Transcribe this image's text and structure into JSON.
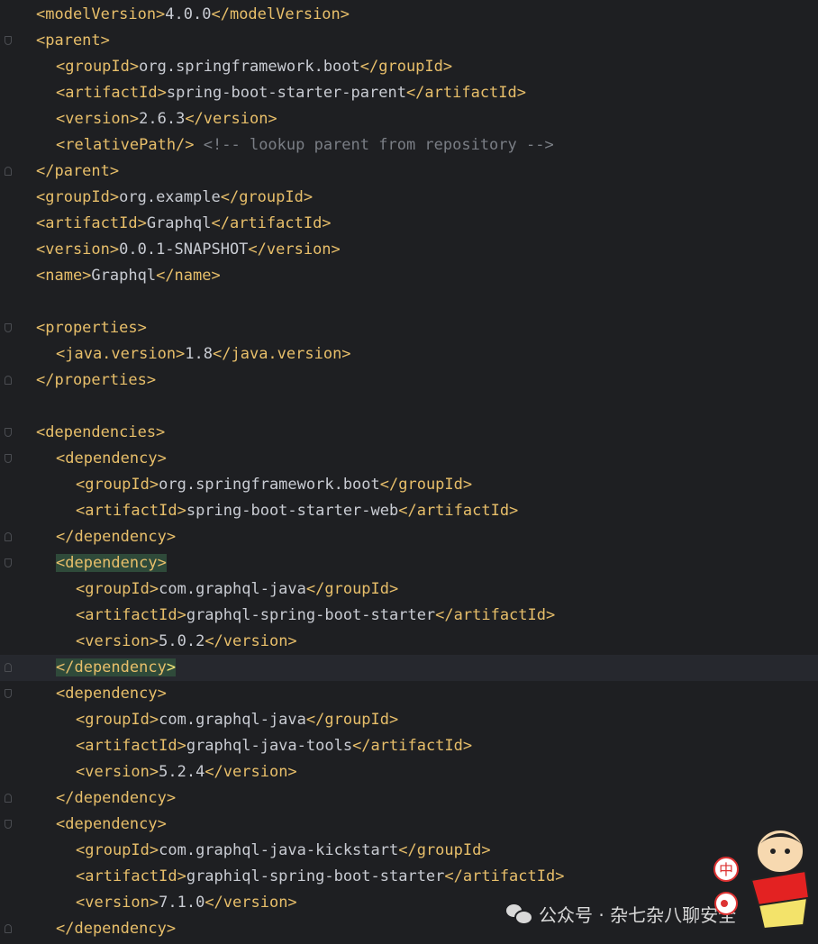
{
  "editor": {
    "lines": [
      {
        "indent": 0,
        "fold": "",
        "segments": [
          [
            "tag",
            "<modelVersion>"
          ],
          [
            "text",
            "4.0.0"
          ],
          [
            "tag",
            "</modelVersion>"
          ]
        ]
      },
      {
        "indent": 0,
        "fold": "down",
        "segments": [
          [
            "tag",
            "<parent>"
          ]
        ]
      },
      {
        "indent": 1,
        "fold": "",
        "segments": [
          [
            "tag",
            "<groupId>"
          ],
          [
            "text",
            "org.springframework.boot"
          ],
          [
            "tag",
            "</groupId>"
          ]
        ]
      },
      {
        "indent": 1,
        "fold": "",
        "segments": [
          [
            "tag",
            "<artifactId>"
          ],
          [
            "text",
            "spring-boot-starter-parent"
          ],
          [
            "tag",
            "</artifactId>"
          ]
        ]
      },
      {
        "indent": 1,
        "fold": "",
        "segments": [
          [
            "tag",
            "<version>"
          ],
          [
            "text",
            "2.6.3"
          ],
          [
            "tag",
            "</version>"
          ]
        ]
      },
      {
        "indent": 1,
        "fold": "",
        "segments": [
          [
            "tag",
            "<relativePath/>"
          ],
          [
            "text",
            " "
          ],
          [
            "comment",
            "<!-- lookup parent from repository -->"
          ]
        ]
      },
      {
        "indent": 0,
        "fold": "up",
        "segments": [
          [
            "tag",
            "</parent>"
          ]
        ]
      },
      {
        "indent": 0,
        "fold": "",
        "segments": [
          [
            "tag",
            "<groupId>"
          ],
          [
            "text",
            "org.example"
          ],
          [
            "tag",
            "</groupId>"
          ]
        ]
      },
      {
        "indent": 0,
        "fold": "",
        "segments": [
          [
            "tag",
            "<artifactId>"
          ],
          [
            "text",
            "Graphql"
          ],
          [
            "tag",
            "</artifactId>"
          ]
        ]
      },
      {
        "indent": 0,
        "fold": "",
        "segments": [
          [
            "tag",
            "<version>"
          ],
          [
            "text",
            "0.0.1-SNAPSHOT"
          ],
          [
            "tag",
            "</version>"
          ]
        ]
      },
      {
        "indent": 0,
        "fold": "",
        "segments": [
          [
            "tag",
            "<name>"
          ],
          [
            "text",
            "Graphql"
          ],
          [
            "tag",
            "</name>"
          ]
        ]
      },
      {
        "indent": 0,
        "fold": "",
        "segments": []
      },
      {
        "indent": 0,
        "fold": "down",
        "segments": [
          [
            "tag",
            "<properties>"
          ]
        ]
      },
      {
        "indent": 1,
        "fold": "",
        "segments": [
          [
            "tag",
            "<java.version>"
          ],
          [
            "text",
            "1.8"
          ],
          [
            "tag",
            "</java.version>"
          ]
        ]
      },
      {
        "indent": 0,
        "fold": "up",
        "segments": [
          [
            "tag",
            "</properties>"
          ]
        ]
      },
      {
        "indent": 0,
        "fold": "",
        "segments": []
      },
      {
        "indent": 0,
        "fold": "down",
        "segments": [
          [
            "tag",
            "<dependencies>"
          ]
        ]
      },
      {
        "indent": 1,
        "fold": "down",
        "segments": [
          [
            "tag",
            "<dependency>"
          ]
        ]
      },
      {
        "indent": 2,
        "fold": "",
        "segments": [
          [
            "tag",
            "<groupId>"
          ],
          [
            "text",
            "org.springframework.boot"
          ],
          [
            "tag",
            "</groupId>"
          ]
        ]
      },
      {
        "indent": 2,
        "fold": "",
        "segments": [
          [
            "tag",
            "<artifactId>"
          ],
          [
            "text",
            "spring-boot-starter-web"
          ],
          [
            "tag",
            "</artifactId>"
          ]
        ]
      },
      {
        "indent": 1,
        "fold": "up",
        "segments": [
          [
            "tag",
            "</dependency>"
          ]
        ]
      },
      {
        "indent": 1,
        "fold": "down",
        "highlight": true,
        "segments": [
          [
            "tag",
            "<dependency>"
          ]
        ]
      },
      {
        "indent": 2,
        "fold": "",
        "segments": [
          [
            "tag",
            "<groupId>"
          ],
          [
            "text",
            "com.graphql-java"
          ],
          [
            "tag",
            "</groupId>"
          ]
        ]
      },
      {
        "indent": 2,
        "fold": "",
        "segments": [
          [
            "tag",
            "<artifactId>"
          ],
          [
            "text",
            "graphql-spring-boot-starter"
          ],
          [
            "tag",
            "</artifactId>"
          ]
        ]
      },
      {
        "indent": 2,
        "fold": "",
        "segments": [
          [
            "tag",
            "<version>"
          ],
          [
            "text",
            "5.0.2"
          ],
          [
            "tag",
            "</version>"
          ]
        ]
      },
      {
        "indent": 1,
        "fold": "up",
        "highlight": true,
        "caret": true,
        "segments": [
          [
            "tag",
            "</dependency"
          ],
          [
            "bracket",
            ">"
          ]
        ]
      },
      {
        "indent": 1,
        "fold": "down",
        "segments": [
          [
            "tag",
            "<dependency>"
          ]
        ]
      },
      {
        "indent": 2,
        "fold": "",
        "segments": [
          [
            "tag",
            "<groupId>"
          ],
          [
            "text",
            "com.graphql-java"
          ],
          [
            "tag",
            "</groupId>"
          ]
        ]
      },
      {
        "indent": 2,
        "fold": "",
        "segments": [
          [
            "tag",
            "<artifactId>"
          ],
          [
            "text",
            "graphql-java-tools"
          ],
          [
            "tag",
            "</artifactId>"
          ]
        ]
      },
      {
        "indent": 2,
        "fold": "",
        "segments": [
          [
            "tag",
            "<version>"
          ],
          [
            "text",
            "5.2.4"
          ],
          [
            "tag",
            "</version>"
          ]
        ]
      },
      {
        "indent": 1,
        "fold": "up",
        "segments": [
          [
            "tag",
            "</dependency>"
          ]
        ]
      },
      {
        "indent": 1,
        "fold": "down",
        "segments": [
          [
            "tag",
            "<dependency>"
          ]
        ]
      },
      {
        "indent": 2,
        "fold": "",
        "segments": [
          [
            "tag",
            "<groupId>"
          ],
          [
            "text",
            "com.graphql-java-kickstart"
          ],
          [
            "tag",
            "</groupId>"
          ]
        ]
      },
      {
        "indent": 2,
        "fold": "",
        "segments": [
          [
            "tag",
            "<artifactId>"
          ],
          [
            "text",
            "graphiql-spring-boot-starter"
          ],
          [
            "tag",
            "</artifactId>"
          ]
        ]
      },
      {
        "indent": 2,
        "fold": "",
        "segments": [
          [
            "tag",
            "<version>"
          ],
          [
            "text",
            "7.1.0"
          ],
          [
            "tag",
            "</version>"
          ]
        ]
      },
      {
        "indent": 1,
        "fold": "up",
        "segments": [
          [
            "tag",
            "</dependency>"
          ]
        ]
      }
    ]
  },
  "watermark": {
    "icon": "wechat-icon",
    "text": "公众号 · 杂七杂八聊安全"
  },
  "sticker": {
    "badge_top": "中",
    "icon": "cartoon-character-sticker"
  },
  "colors": {
    "background": "#1e1f22",
    "tag": "#e8bf6a",
    "text": "#c9ccd3",
    "comment": "#7a7e85",
    "tag_match_highlight": "#2f4a3a"
  }
}
